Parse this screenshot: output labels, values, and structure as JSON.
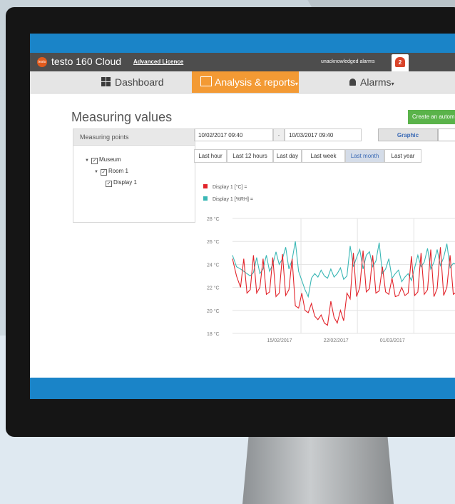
{
  "header": {
    "brand": "testo 160 Cloud",
    "licence": "Advanced Licence",
    "unack_label": "unacknowledged alarms",
    "alarm_count": "2",
    "logo_text": "testo"
  },
  "nav": {
    "dashboard": "Dashboard",
    "analysis": "Analysis & reports",
    "alarms": "Alarms"
  },
  "page": {
    "title": "Measuring values",
    "create_button": "Create an automa"
  },
  "measuring_points": {
    "heading": "Measuring points",
    "tree": [
      {
        "label": "Museum"
      },
      {
        "label": "Room 1"
      },
      {
        "label": "Display 1"
      }
    ]
  },
  "range": {
    "from": "10/02/2017 09:40",
    "separator": "-",
    "to": "10/03/2017 09:40",
    "view_graphic": "Graphic",
    "buttons": [
      "Last hour",
      "Last 12 hours",
      "Last day",
      "Last week",
      "Last month",
      "Last year"
    ],
    "active": "Last month"
  },
  "colors": {
    "temperature": "#e2232a",
    "humidity": "#3ab7b5",
    "accent": "#f39a34",
    "brand_blue": "#1a84c8"
  },
  "chart_data": {
    "type": "line",
    "legend": [
      "Display 1 [°C] =",
      "Display 1 [%RH] ="
    ],
    "yticks": [
      "28 °C",
      "26 °C",
      "24 °C",
      "22 °C",
      "20 °C",
      "18 °C"
    ],
    "ylim": [
      18,
      28
    ],
    "xticks": [
      "15/02/2017",
      "22/02/2017",
      "01/03/2017"
    ],
    "series": [
      {
        "name": "Display 1 [°C] =",
        "color": "#e2232a",
        "x_days": [
          0,
          0.5,
          1,
          1.4,
          1.8,
          2.2,
          2.6,
          3,
          3.4,
          3.8,
          4.2,
          4.6,
          5,
          5.4,
          5.8,
          6.2,
          6.6,
          7,
          7.4,
          7.8,
          8.2,
          8.6,
          9,
          9.4,
          9.8,
          10.2,
          10.6,
          11,
          11.4,
          11.8,
          12.2,
          12.6,
          13,
          13.4,
          13.8,
          14.2,
          14.6,
          15,
          15.4,
          15.8,
          16.2,
          16.6,
          17,
          17.4,
          17.8,
          18.2,
          18.6,
          19,
          19.4,
          19.8,
          20.2,
          20.6,
          21,
          21.4,
          21.8,
          22.2,
          22.6,
          23,
          23.4,
          23.8,
          24.2,
          24.6,
          25,
          25.4,
          25.8,
          26.2,
          26.6,
          27,
          27.4,
          27.8,
          28.2
        ],
        "values": [
          24.5,
          23.0,
          22.0,
          24.5,
          21.5,
          21.8,
          24.8,
          21.5,
          22.0,
          24.5,
          21.4,
          21.6,
          24.6,
          21.2,
          21.5,
          24.9,
          21.3,
          21.8,
          24.5,
          20.4,
          20.2,
          21.5,
          20.0,
          19.8,
          20.6,
          19.5,
          19.2,
          19.6,
          18.9,
          18.7,
          20.8,
          19.4,
          18.9,
          20.0,
          19.1,
          21.5,
          21.0,
          25.0,
          21.2,
          22.0,
          25.2,
          21.6,
          21.9,
          24.8,
          21.5,
          21.7,
          23.8,
          21.6,
          21.4,
          22.8,
          21.2,
          21.3,
          22.0,
          21.3,
          21.5,
          24.7,
          21.3,
          21.6,
          25.0,
          21.4,
          21.8,
          25.3,
          21.2,
          21.9,
          25.5,
          21.3,
          22.0,
          24.8,
          21.4,
          21.6
        ]
      },
      {
        "name": "Display 1 [%RH] =",
        "color": "#3ab7b5",
        "x_days": [
          0,
          0.5,
          1,
          1.4,
          1.8,
          2.2,
          2.6,
          3,
          3.4,
          3.8,
          4.2,
          4.6,
          5,
          5.4,
          5.8,
          6.2,
          6.6,
          7,
          7.4,
          7.8,
          8.2,
          8.6,
          9,
          9.4,
          9.8,
          10.2,
          10.6,
          11,
          11.4,
          11.8,
          12.2,
          12.6,
          13,
          13.4,
          13.8,
          14.2,
          14.6,
          15,
          15.4,
          15.8,
          16.2,
          16.6,
          17,
          17.4,
          17.8,
          18.2,
          18.6,
          19,
          19.4,
          19.8,
          20.2,
          20.6,
          21,
          21.4,
          21.8,
          22.2,
          22.6,
          23,
          23.4,
          23.8,
          24.2,
          24.6,
          25,
          25.4,
          25.8,
          26.2,
          26.6,
          27,
          27.4,
          27.8,
          28.2
        ],
        "values": [
          24.8,
          23.8,
          23.6,
          23.4,
          23.2,
          23.0,
          23.3,
          24.6,
          23.2,
          23.6,
          24.8,
          23.4,
          24.0,
          25.1,
          24.0,
          24.5,
          25.5,
          23.6,
          24.4,
          26.0,
          23.4,
          22.6,
          21.8,
          21.2,
          22.8,
          23.2,
          22.9,
          23.5,
          23.0,
          22.8,
          23.6,
          22.9,
          23.2,
          23.7,
          22.7,
          23.0,
          25.6,
          23.8,
          24.6,
          25.3,
          23.6,
          24.8,
          25.1,
          23.8,
          24.3,
          25.9,
          23.2,
          23.6,
          24.5,
          22.8,
          23.2,
          23.5,
          22.5,
          22.9,
          23.2,
          22.6,
          23.7,
          24.8,
          23.8,
          24.2,
          25.4,
          23.6,
          24.2,
          25.3,
          23.9,
          24.6,
          25.8,
          23.7,
          24.1,
          24.0
        ]
      }
    ]
  }
}
